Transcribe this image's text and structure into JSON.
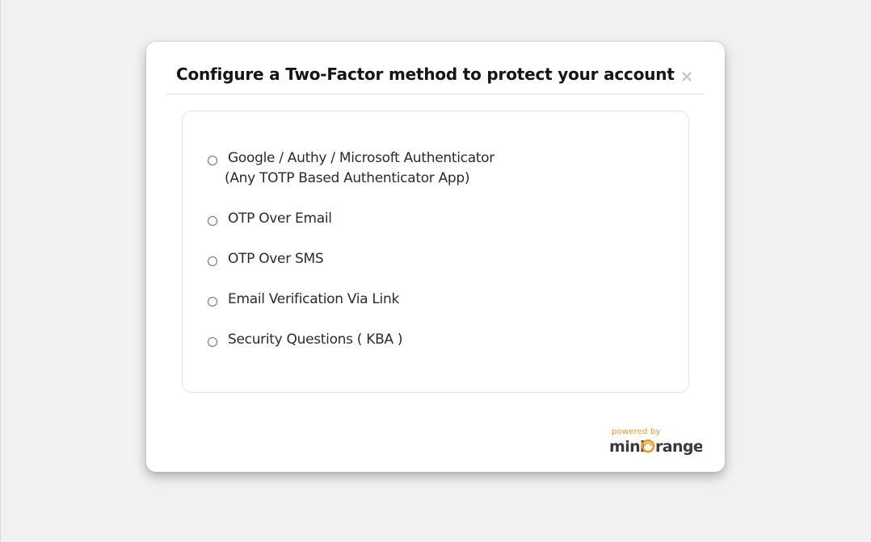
{
  "modal": {
    "title": "Configure a Two-Factor method to protect your account",
    "close_symbol": "×"
  },
  "options": [
    {
      "label": "Google / Authy / Microsoft Authenticator",
      "sublabel": "(Any TOTP Based Authenticator App)",
      "selected": false
    },
    {
      "label": "OTP Over Email",
      "selected": false
    },
    {
      "label": "OTP Over SMS",
      "selected": false
    },
    {
      "label": "Email Verification Via Link",
      "selected": false
    },
    {
      "label": "Security Questions ( KBA )",
      "selected": false
    }
  ],
  "branding": {
    "powered_by": "powered by",
    "logo_text": "miniOrange",
    "accent_color": "#f7931e"
  }
}
